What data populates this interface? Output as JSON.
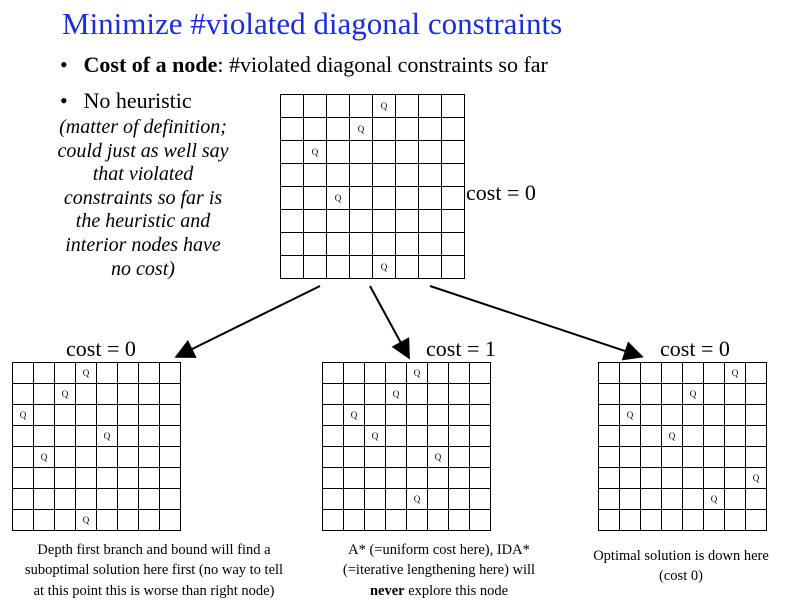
{
  "title": "Minimize #violated diagonal constraints",
  "bullets": {
    "b1_bold": "Cost of a node",
    "b1_rest": ": #violated diagonal constraints so far",
    "b2": "No heuristic"
  },
  "paren_note": "(matter of definition;\ncould just as well say\nthat violated\nconstraints so far is\nthe heuristic and\ninterior nodes have\nno cost)",
  "cost_top": "cost = 0",
  "cost_left": "cost = 0",
  "cost_mid": "cost = 1",
  "cost_right": "cost = 0",
  "captions": {
    "left": "Depth first branch and bound will find a\nsuboptimal solution here first (no way to tell\nat this point this is worse than right node)",
    "mid": "A* (=uniform cost here), IDA*\n(=iterative lengthening here) will\nnever explore this node",
    "mid_never": "never",
    "right": "Optimal solution is down here\n(cost 0)"
  },
  "Q": "Q",
  "boards": {
    "top": {
      "size": 8,
      "queens": [
        [
          0,
          4
        ],
        [
          1,
          3
        ],
        [
          2,
          1
        ],
        [
          4,
          2
        ],
        [
          7,
          4
        ]
      ]
    },
    "left": {
      "size": 8,
      "queens": [
        [
          0,
          3
        ],
        [
          1,
          2
        ],
        [
          2,
          0
        ],
        [
          3,
          4
        ],
        [
          4,
          1
        ],
        [
          7,
          3
        ]
      ]
    },
    "mid": {
      "size": 8,
      "queens": [
        [
          0,
          4
        ],
        [
          1,
          3
        ],
        [
          2,
          1
        ],
        [
          3,
          2
        ],
        [
          4,
          5
        ],
        [
          6,
          4
        ]
      ]
    },
    "right": {
      "size": 8,
      "queens": [
        [
          0,
          6
        ],
        [
          1,
          4
        ],
        [
          2,
          1
        ],
        [
          3,
          3
        ],
        [
          5,
          7
        ],
        [
          6,
          5
        ]
      ]
    }
  }
}
